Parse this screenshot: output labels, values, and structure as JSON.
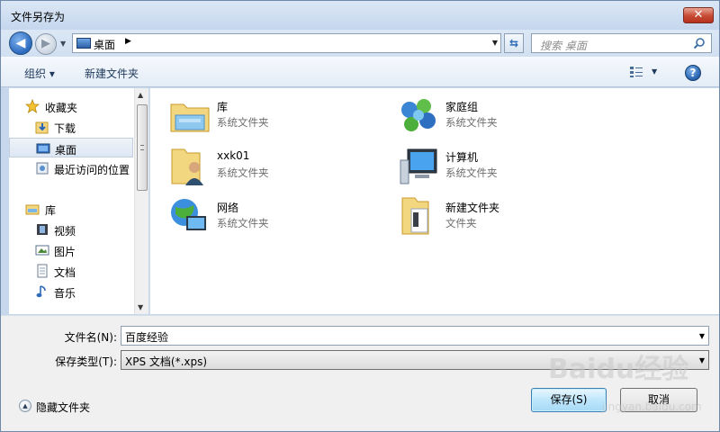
{
  "window": {
    "title": "文件另存为",
    "close_label": "✕"
  },
  "address": {
    "location": "桌面",
    "search_placeholder": "搜索 桌面"
  },
  "toolbar": {
    "organize": "组织 ▾",
    "new_folder": "新建文件夹"
  },
  "nav": {
    "favorites": {
      "label": "收藏夹",
      "items": [
        "下载",
        "桌面",
        "最近访问的位置"
      ]
    },
    "libraries": {
      "label": "库",
      "items": [
        "视频",
        "图片",
        "文档",
        "音乐"
      ]
    }
  },
  "items": [
    {
      "name": "库",
      "desc": "系统文件夹",
      "icon": "library-folder-icon"
    },
    {
      "name": "家庭组",
      "desc": "系统文件夹",
      "icon": "homegroup-icon"
    },
    {
      "name": "xxk01",
      "desc": "系统文件夹",
      "icon": "user-folder-icon"
    },
    {
      "name": "计算机",
      "desc": "系统文件夹",
      "icon": "computer-icon"
    },
    {
      "name": "网络",
      "desc": "系统文件夹",
      "icon": "network-icon"
    },
    {
      "name": "新建文件夹",
      "desc": "文件夹",
      "icon": "folder-icon"
    }
  ],
  "form": {
    "filename_label": "文件名(N):",
    "filename_value": "百度经验",
    "filetype_label": "保存类型(T):",
    "filetype_value": "XPS 文档(*.xps)"
  },
  "footer": {
    "hide_folders": "隐藏文件夹",
    "save": "保存(S)",
    "cancel": "取消"
  },
  "watermark": {
    "brand": "Baidu经验",
    "url": "jingyan.baidu.com"
  }
}
